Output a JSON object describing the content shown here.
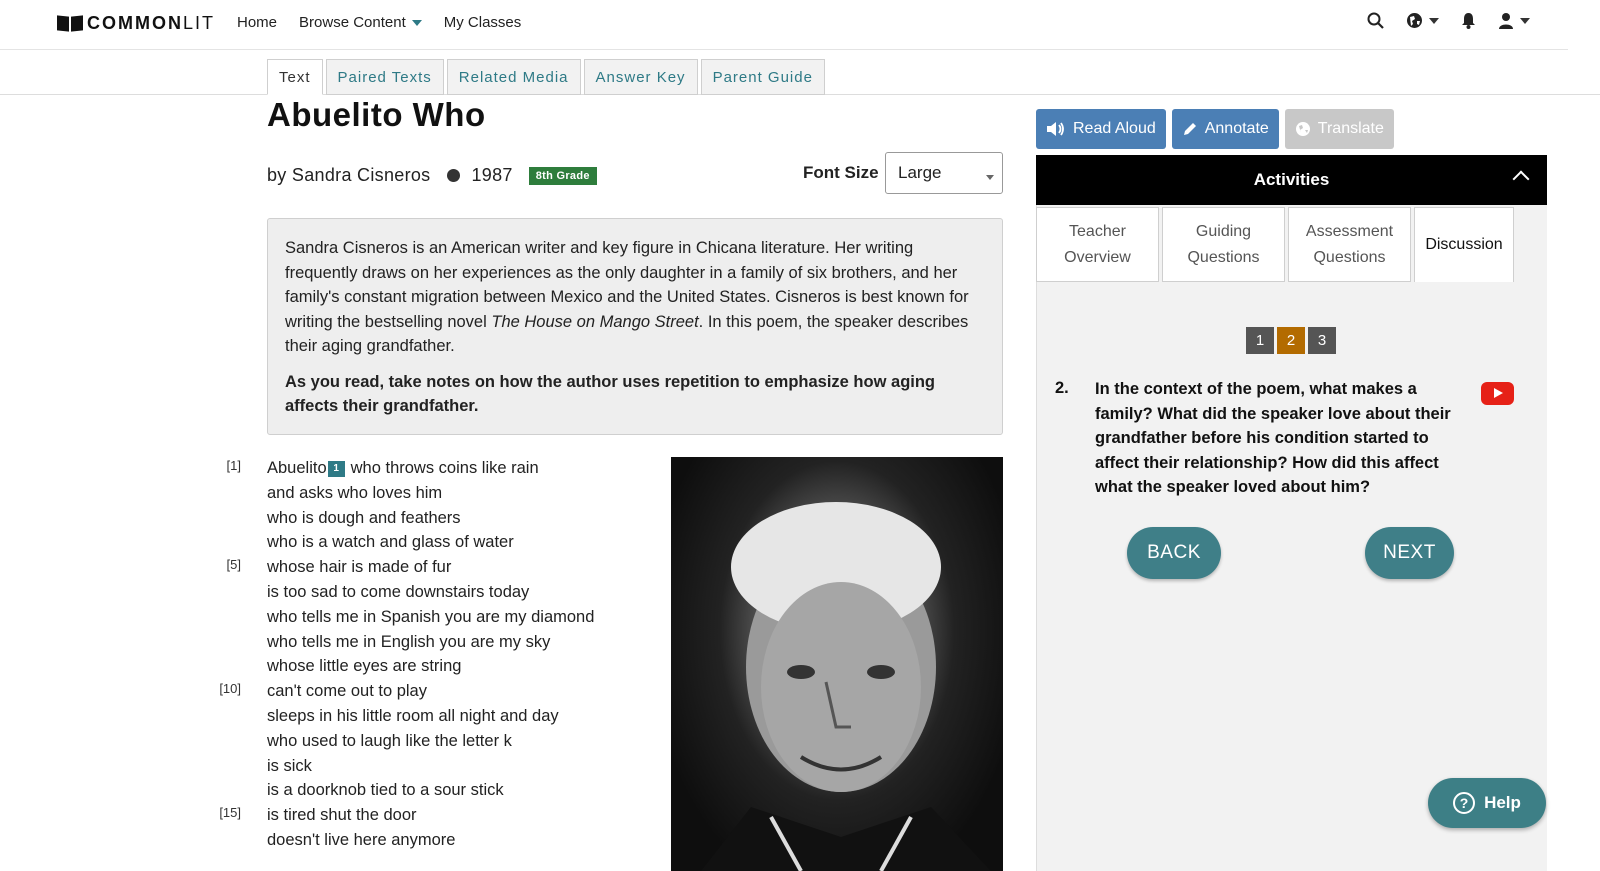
{
  "nav": {
    "logo_bold": "COMMON",
    "logo_light": "LIT",
    "links": [
      "Home",
      "Browse Content",
      "My Classes"
    ],
    "icons": [
      "search-icon",
      "globe-icon",
      "bell-icon",
      "user-icon"
    ]
  },
  "tabs": [
    "Text",
    "Paired Texts",
    "Related Media",
    "Answer Key",
    "Parent Guide"
  ],
  "text": {
    "title": "Abuelito Who",
    "author": "by Sandra Cisneros",
    "year": "1987",
    "grade": "8th Grade",
    "font_size_label": "Font Size",
    "font_size_value": "Large",
    "intro_part1": "Sandra Cisneros is an American writer and key figure in Chicana literature. Her writing frequently draws on her experiences as the only daughter in a family of six brothers, and her family's constant migration between Mexico and the United States. Cisneros is best known for writing the bestselling novel ",
    "intro_book": "The House on Mango Street",
    "intro_part2": ". In this poem, the speaker describes their aging grandfather.",
    "intro_prompt": "As you read, take notes on how the author uses repetition to emphasize how aging affects their grandfather.",
    "footnote_marker": "1",
    "poem": [
      {
        "num": "[1]",
        "pre": "Abuelito",
        "text": "who throws coins like rain"
      },
      {
        "num": "",
        "text": "and asks who loves him"
      },
      {
        "num": "",
        "text": "who is dough and feathers"
      },
      {
        "num": "",
        "text": "who is a watch and glass of water"
      },
      {
        "num": "[5]",
        "text": "whose hair is made of fur"
      },
      {
        "num": "",
        "text": "is too sad to come downstairs today"
      },
      {
        "num": "",
        "text": "who tells me in Spanish you are my diamond"
      },
      {
        "num": "",
        "text": "who tells me in English you are my sky"
      },
      {
        "num": "",
        "text": "whose little eyes are string"
      },
      {
        "num": "[10]",
        "text": "can't come out to play"
      },
      {
        "num": "",
        "text": "sleeps in his little room all night and day"
      },
      {
        "num": "",
        "text": "who used to laugh like the letter k"
      },
      {
        "num": "",
        "text": "is sick"
      },
      {
        "num": "",
        "text": "is a doorknob tied to a sour stick"
      },
      {
        "num": "[15]",
        "text": "is tired shut the door"
      },
      {
        "num": "",
        "text": "doesn't live here anymore"
      }
    ]
  },
  "tools": {
    "read_aloud": "Read Aloud",
    "annotate": "Annotate",
    "translate": "Translate"
  },
  "activities": {
    "header": "Activities",
    "tabs": [
      "Teacher Overview",
      "Guiding Questions",
      "Assessment Questions",
      "Discussion"
    ],
    "pages": [
      "1",
      "2",
      "3"
    ],
    "current_page": "2",
    "question_number": "2.",
    "question": "In the context of the poem, what makes a family? What did the speaker love about their grandfather before his condition started to affect their relationship? How did this affect what the speaker loved about him?",
    "back": "BACK",
    "next": "NEXT"
  },
  "help": {
    "label": "Help",
    "icon": "?"
  },
  "colors": {
    "teal": "#2e7a86",
    "tool_blue": "#4b7fb5",
    "grade_green": "#2e7d3c",
    "current_page": "#b36b00"
  }
}
